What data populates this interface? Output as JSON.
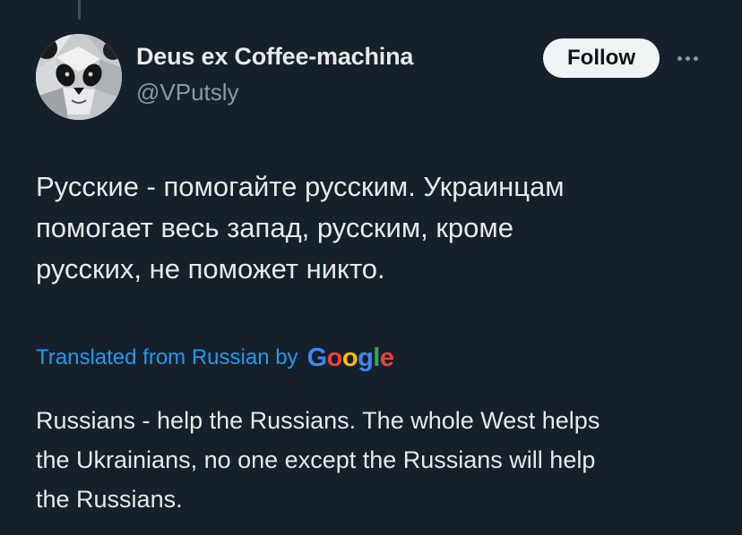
{
  "author": {
    "display_name": "Deus ex Coffee-machina",
    "handle": "@VPutsly",
    "avatar_icon": "panda-avatar-icon"
  },
  "follow_button": {
    "label": "Follow"
  },
  "more_menu": {
    "icon": "more-horizontal-icon"
  },
  "tweet": {
    "lines": [
      "Русские - помогайте русским. Украинцам",
      "помогает весь запад, русским, кроме",
      "русских, не поможет никто."
    ]
  },
  "translation": {
    "label": "Translated from Russian by",
    "provider_letters": [
      "G",
      "o",
      "o",
      "g",
      "l",
      "e"
    ],
    "provider_colors": [
      "#4285f4",
      "#ea4335",
      "#fbbc05",
      "#4285f4",
      "#34a853",
      "#ea4335"
    ],
    "lines": [
      "Russians - help the Russians. The whole West helps",
      "the Ukrainians, no one except the Russians will help",
      "the Russians."
    ]
  },
  "colors": {
    "background": "#15202b",
    "primary_text": "#e7e9ea",
    "secondary_text": "#8b98a5",
    "link": "#1d9bf0",
    "follow_bg": "#eff3f4"
  }
}
